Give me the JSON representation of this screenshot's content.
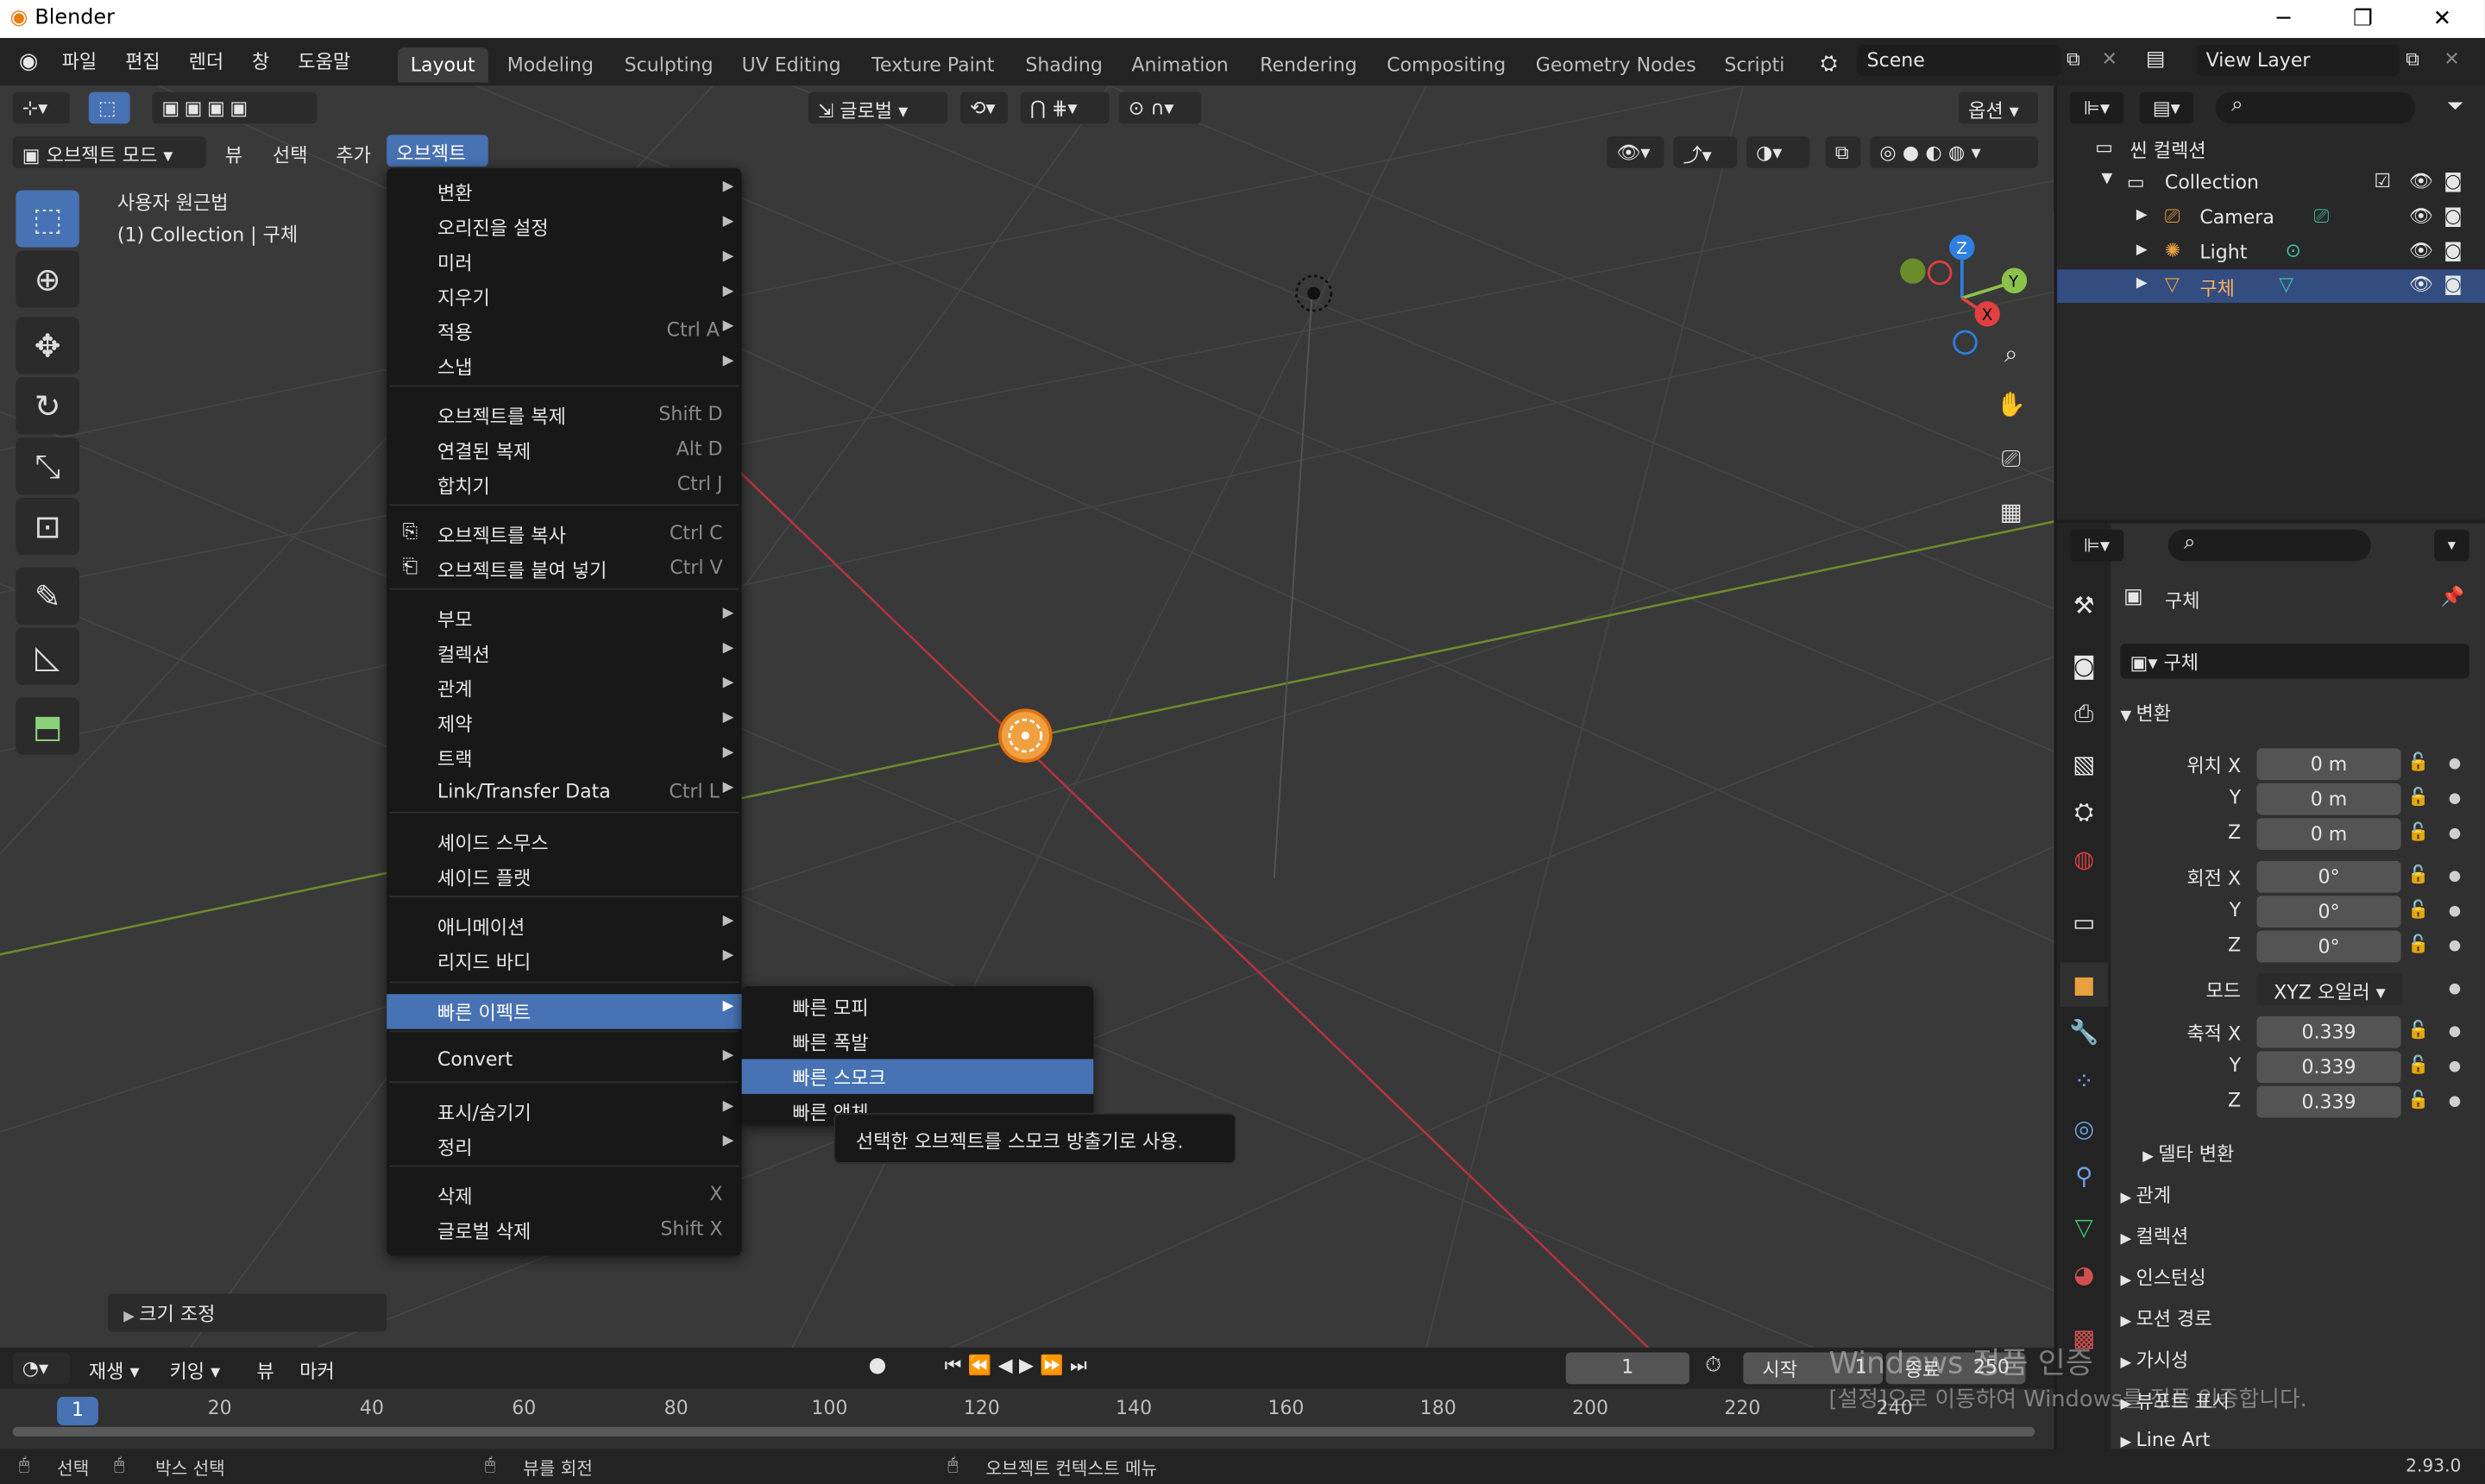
{
  "window": {
    "title": "Blender"
  },
  "topmenu": [
    "파일",
    "편집",
    "렌더",
    "창",
    "도움말"
  ],
  "workspaces": [
    "Layout",
    "Modeling",
    "Sculpting",
    "UV Editing",
    "Texture Paint",
    "Shading",
    "Animation",
    "Rendering",
    "Compositing",
    "Geometry Nodes",
    "Scripti"
  ],
  "scene": "Scene",
  "view_layer": "View Layer",
  "viewport": {
    "mode": "오브젝트 모드",
    "menus": [
      "뷰",
      "선택",
      "추가",
      "오브젝트"
    ],
    "transform_orient": "글로벌",
    "options": "옵션",
    "overlay_text": [
      "사용자 원근법",
      "(1) Collection | 구체"
    ],
    "last_op": "크기 조정"
  },
  "object_menu": {
    "items": [
      {
        "label": "변환",
        "shortcut": "",
        "sub": true
      },
      {
        "label": "오리진을 설정",
        "shortcut": "",
        "sub": true
      },
      {
        "label": "미러",
        "shortcut": "",
        "sub": true
      },
      {
        "label": "지우기",
        "shortcut": "",
        "sub": true
      },
      {
        "label": "적용",
        "shortcut": "Ctrl A",
        "sub": true
      },
      {
        "label": "스냅",
        "shortcut": "",
        "sub": true
      },
      {
        "label": "오브젝트를 복제",
        "shortcut": "Shift D",
        "sub": false
      },
      {
        "label": "연결된 복제",
        "shortcut": "Alt D",
        "sub": false
      },
      {
        "label": "합치기",
        "shortcut": "Ctrl J",
        "sub": false
      },
      {
        "label": "오브젝트를 복사",
        "shortcut": "Ctrl C",
        "sub": false
      },
      {
        "label": "오브젝트를 붙여 넣기",
        "shortcut": "Ctrl V",
        "sub": false
      },
      {
        "label": "부모",
        "shortcut": "",
        "sub": true
      },
      {
        "label": "컬렉션",
        "shortcut": "",
        "sub": true
      },
      {
        "label": "관계",
        "shortcut": "",
        "sub": true
      },
      {
        "label": "제약",
        "shortcut": "",
        "sub": true
      },
      {
        "label": "트랙",
        "shortcut": "",
        "sub": true
      },
      {
        "label": "Link/Transfer Data",
        "shortcut": "Ctrl L",
        "sub": true
      },
      {
        "label": "셰이드 스무스",
        "shortcut": "",
        "sub": false
      },
      {
        "label": "셰이드 플랫",
        "shortcut": "",
        "sub": false
      },
      {
        "label": "애니메이션",
        "shortcut": "",
        "sub": true
      },
      {
        "label": "리지드 바디",
        "shortcut": "",
        "sub": true
      },
      {
        "label": "빠른 이펙트",
        "shortcut": "",
        "sub": true
      },
      {
        "label": "Convert",
        "shortcut": "",
        "sub": true
      },
      {
        "label": "표시/숨기기",
        "shortcut": "",
        "sub": true
      },
      {
        "label": "정리",
        "shortcut": "",
        "sub": true
      },
      {
        "label": "삭제",
        "shortcut": "X",
        "sub": false
      },
      {
        "label": "글로벌 삭제",
        "shortcut": "Shift X",
        "sub": false
      }
    ]
  },
  "quick_effects": {
    "items": [
      "빠른 모피",
      "빠른 폭발",
      "빠른 스모크",
      "빠른 액체"
    ],
    "tooltip": "선택한 오브젝트를 스모크 방출기로 사용."
  },
  "outliner": {
    "root": "씬 컬렉션",
    "collection": "Collection",
    "objects": [
      "Camera",
      "Light",
      "구체"
    ]
  },
  "properties": {
    "object_name": "구체",
    "datablock": "구체",
    "section_transform": "변환",
    "location_label": "위치",
    "rotation_label": "회전",
    "scale_label": "축적",
    "mode_label": "모드",
    "location": [
      "0 m",
      "0 m",
      "0 m"
    ],
    "rotation": [
      "0°",
      "0°",
      "0°"
    ],
    "scale": [
      "0.339",
      "0.339",
      "0.339"
    ],
    "rotation_mode": "XYZ 오일러",
    "delta": "델타 변환",
    "sections": [
      "관계",
      "컬렉션",
      "인스턴싱",
      "모션 경로",
      "가시성",
      "뷰포트 표시",
      "Line Art"
    ],
    "axis": [
      "X",
      "Y",
      "Z"
    ]
  },
  "timeline": {
    "menus": [
      "재생",
      "키잉",
      "뷰",
      "마커"
    ],
    "current_frame": "1",
    "start_label": "시작",
    "start": "1",
    "end_label": "종료",
    "end": "250",
    "ticks": [
      "20",
      "40",
      "60",
      "80",
      "100",
      "120",
      "140",
      "160",
      "180",
      "200",
      "220",
      "240"
    ],
    "cursor": "1"
  },
  "status": {
    "select": "선택",
    "box_select": "박스 선택",
    "rotate": "뷰를 회전",
    "context": "오브젝트 컨텍스트 메뉴",
    "version": "2.93.0"
  },
  "watermark": {
    "line1": "Windows 정품 인증",
    "line2": "[설정]으로 이동하여 Windows를 정품 인증합니다."
  }
}
